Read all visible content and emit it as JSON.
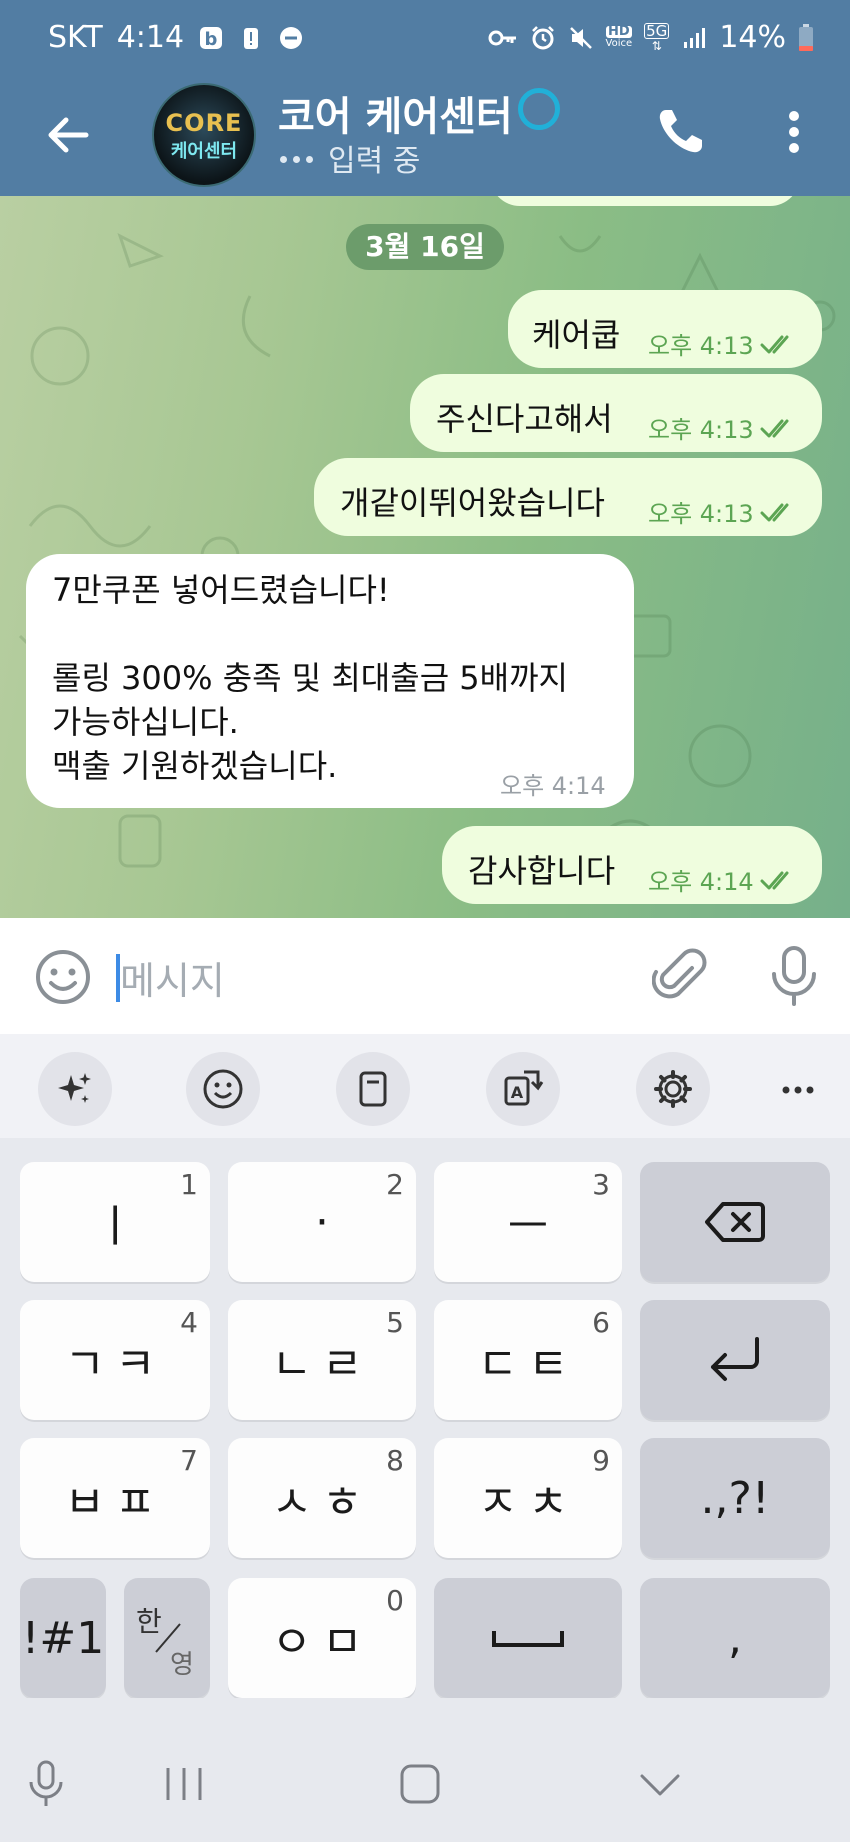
{
  "status_bar": {
    "carrier": "SKT",
    "time": "4:14",
    "battery": "14%",
    "hd_label": "HD",
    "network": "5G"
  },
  "header": {
    "title": "코어 케어센터",
    "status": "입력 중",
    "avatar_logo_top": "CORE",
    "avatar_logo_bottom": "케어센터"
  },
  "chat": {
    "date_label": "3월 16일",
    "messages": [
      {
        "direction": "out",
        "text": "케어쿱",
        "time": "오후 4:13"
      },
      {
        "direction": "out",
        "text": "주신다고해서",
        "time": "오후 4:13"
      },
      {
        "direction": "out",
        "text": "개같이뛰어왔습니다",
        "time": "오후 4:13"
      },
      {
        "direction": "in",
        "lines": [
          "7만쿠폰 넣어드렸습니다!",
          "",
          "롤링 300% 충족 및 최대출금 5배까지",
          "가능하십니다.",
          "맥출 기원하겠습니다."
        ],
        "time": "오후 4:14"
      },
      {
        "direction": "out",
        "text": "감사합니다",
        "time": "오후 4:14"
      }
    ]
  },
  "input": {
    "placeholder": "메시지"
  },
  "keyboard": {
    "rows": [
      [
        {
          "label": "ㅣ",
          "num": "1"
        },
        {
          "label": "·",
          "num": "2"
        },
        {
          "label": "ㅡ",
          "num": "3"
        },
        {
          "label": "backspace"
        }
      ],
      [
        {
          "label": "ㄱㅋ",
          "num": "4"
        },
        {
          "label": "ㄴㄹ",
          "num": "5"
        },
        {
          "label": "ㄷㅌ",
          "num": "6"
        },
        {
          "label": "enter"
        }
      ],
      [
        {
          "label": "ㅂㅍ",
          "num": "7"
        },
        {
          "label": "ㅅㅎ",
          "num": "8"
        },
        {
          "label": "ㅈㅊ",
          "num": "9"
        },
        {
          "label": ".,?!"
        }
      ],
      [
        {
          "label": "!#1"
        },
        {
          "label_top": "한",
          "label_bottom": "영"
        },
        {
          "label": "ㅇㅁ",
          "num": "0"
        },
        {
          "label": "space"
        },
        {
          "label": ","
        }
      ]
    ]
  },
  "colors": {
    "header_bg": "#527da3",
    "out_bubble": "#effdde",
    "out_meta": "#5ca553",
    "in_bubble": "#ffffff",
    "date_pill": "#6c9c6b",
    "caret": "#3d8be5"
  }
}
